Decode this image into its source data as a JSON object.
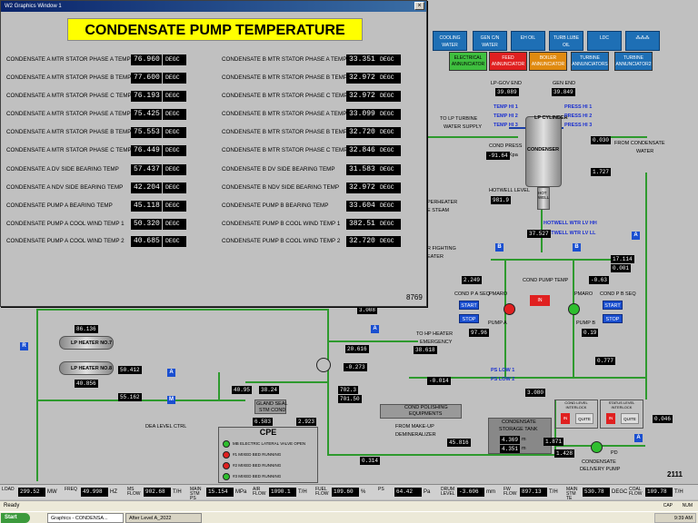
{
  "popup": {
    "window_title": "W2 Graphics Window 1",
    "close_glyph": "×",
    "banner": "CONDENSATE PUMP TEMPERATURE",
    "code": "8769",
    "left_rows": [
      {
        "label": "CONDENSATE  A MTR STATOR PHASE A TEMP 1",
        "value": "76.960",
        "unit": "DEGC"
      },
      {
        "label": "CONDENSATE  A MTR STATOR PHASE B TEMP 1",
        "value": "77.600",
        "unit": "DEGC"
      },
      {
        "label": "CONDENSATE  A MTR STATOR PHASE C TEMP 1",
        "value": "76.193",
        "unit": "DEGC"
      },
      {
        "label": "CONDENSATE  A MTR STATOR PHASE A TEMP 2",
        "value": "75.425",
        "unit": "DEGC"
      },
      {
        "label": "CONDENSATE  A MTR STATOR PHASE B TEMP 2",
        "value": "75.553",
        "unit": "DEGC"
      },
      {
        "label": "CONDENSATE  A MTR STATOR PHASE C TEMP 2",
        "value": "76.449",
        "unit": "DEGC"
      },
      {
        "label": "CONDENSATE A DV SIDE BEARING TEMP",
        "value": "57.437",
        "unit": "DEGC"
      },
      {
        "label": "CONDENSATE A NDV SIDE BEARING TEMP",
        "value": "42.204",
        "unit": "DEGC"
      },
      {
        "label": "CONDENSATE PUMP A BEARING TEMP",
        "value": "45.118",
        "unit": "DEGC"
      },
      {
        "label": "CONDENSATE PUMP A COOL WIND TEMP 1",
        "value": "50.320",
        "unit": "DEGC"
      },
      {
        "label": "CONDENSATE PUMP A COOL WIND TEMP 2",
        "value": "40.685",
        "unit": "DEGC"
      }
    ],
    "right_rows": [
      {
        "label": "CONDENSATE  B MTR STATOR PHASE A TEMP 1",
        "value": "33.351",
        "unit": "DEGC"
      },
      {
        "label": "CONDENSATE  B MTR STATOR PHASE B TEMP 1",
        "value": "32.972",
        "unit": "DEGC"
      },
      {
        "label": "CONDENSATE  B MTR STATOR PHASE C TEMP 1",
        "value": "32.972",
        "unit": "DEGC"
      },
      {
        "label": "CONDENSATE  B MTR STATOR PHASE A TEMP 2",
        "value": "33.099",
        "unit": "DEGC"
      },
      {
        "label": "CONDENSATE  B MTR STATOR PHASE B TEMP 2",
        "value": "32.720",
        "unit": "DEGC"
      },
      {
        "label": "CONDENSATE  B MTR STATOR PHASE C TEMP 2",
        "value": "32.846",
        "unit": "DEGC"
      },
      {
        "label": "CONDENSATE B DV SIDE BEARING TEMP",
        "value": "31.583",
        "unit": "DEGC"
      },
      {
        "label": "CONDENSATE B NDV SIDE BEARING TEMP",
        "value": "32.972",
        "unit": "DEGC"
      },
      {
        "label": "CONDENSATE PUMP B BEARING TEMP",
        "value": "33.604",
        "unit": "DEGC"
      },
      {
        "label": "CONDENSATE PUMP B COOL WIND TEMP 1",
        "value": "382.51",
        "unit": "DEGC"
      },
      {
        "label": "CONDENSATE PUMP B COOL WIND TEMP 2",
        "value": "32.720",
        "unit": "DEGC"
      }
    ]
  },
  "topbar": {
    "buttons": [
      "COOLING WATER",
      "GEN C/N WATER",
      "EH OIL",
      "TURB LUBE OIL",
      "LDC"
    ],
    "annunciators": [
      {
        "label": "ELECTRICAL ANNUNCIATOR",
        "color": "#3fbf3f"
      },
      {
        "label": "FEED ANNUNCIATOR",
        "color": "#e02020"
      },
      {
        "label": "BOILER ANNUNCIATOR",
        "color": "#e08a10"
      },
      {
        "label": "TURBINE ANNUNCIATORS",
        "color": "#1e6fb5"
      },
      {
        "label": "TURBINE ANNUNCIATOR2",
        "color": "#1e6fb5"
      }
    ]
  },
  "scada": {
    "labels": {
      "lp_gov_end": "LP-GOV END",
      "gen_end": "GEN END",
      "lp_gov_val": "39.089",
      "gen_end_val": "39.849",
      "lp_cylinder": "LP CYLINDER",
      "to_lp_turbine": "TO LP TURBINE",
      "water_supply": "WATER SUPPLY",
      "temp_hi1": "TEMP HI 1",
      "temp_hi2": "TEMP HI 2",
      "temp_hi3": "TEMP HI 3",
      "press_hi1": "PRESS HI 1",
      "press_hi2": "PRESS HI 2",
      "press_hi3": "PRESS HI 3",
      "cond_press": "COND PRESS",
      "cond_press_val": "-91.64",
      "cond_press_unit": "Kpa",
      "condenser": "CONDENSER",
      "hotwell_level": "HOTWELL LEVEL",
      "hotwell_level_val": "981.9",
      "hot_well": "HOT WELL",
      "hotwell_hh": "HOTWELL WTR LV HH",
      "hotwell_ll": "HOTWELL WTR LV LL",
      "superheater": "PERHEATER",
      "steam": "E STEAM",
      "fighting": "R FIGHTING",
      "heater": "EATER",
      "from_condensate": "FROM CONDENSATE",
      "water": "WATER",
      "from_cond_val1": "0.030",
      "from_cond_val2": "1.727",
      "val_37": "37.527",
      "val_2249": "2.249",
      "val_063": "-0.63",
      "cond_pump_temp": "COND PUMP TEMP",
      "cond_p_a_seq": "COND P A SEQ",
      "cond_p_b_seq": "COND P B SEQ",
      "pmaro_a": "PMARO",
      "pmaro_b": "PMARO",
      "start": "START",
      "stop": "STOP",
      "pump_a": "PUMP A",
      "pump_b": "PUMP B",
      "pump_a_val": "97.96",
      "pump_b_val": "0.19",
      "ps_low1": "PS LOW 1",
      "ps_low2": "PS LOW 2",
      "val_17114": "17.114",
      "val_0001": "0.001",
      "val_0777": "0.777",
      "val_3080": "3.080",
      "lp_heater7": "LP HEATER NO.7",
      "lp_heater8": "LP HEATER NO.8",
      "lp7_val": "86.136",
      "lp8_val": "40.856",
      "lp_a_val": "50.412",
      "lp_b_val": "55.162",
      "val_3008": "3.008",
      "to_hp_heater": "TO HP HEATER",
      "emergency": "EMERGENCY",
      "val_2061": "20.616",
      "val_3861": "38.618",
      "val_0273": "-0.273",
      "val_4095": "40.95",
      "val_3824": "38.24",
      "gland_seal": "GLAND SEAL",
      "stm_cond": "STM COND",
      "val_6583": "6.583",
      "val_2923": "2.923",
      "val_7023": "702.3",
      "val_7015": "701.50",
      "val_neg001": "-0.014",
      "cond_polishing": "COND POLISHING",
      "equipments": "EQUIPMENTS",
      "from_make_up": "FROM MAKE-UP",
      "demineralizer": "DEMINERALIZER",
      "val_4581": "45.816",
      "val_0314": "0.314",
      "cond_storage_tank": "CONDENSATE",
      "storage_tank": "STORAGE TANK",
      "tank_val1": "4.369",
      "tank_val2": "4.351",
      "tank_unit": "m",
      "val_1871": "1.871",
      "val_1428": "1.428",
      "cond_delivery_pump": "CONDENSATE",
      "delivery_pump": "DELIVERY PUMP",
      "pd": "PD",
      "dea_level": "DEA LEVEL CTRL",
      "cpe": "CPE",
      "cpe_items": [
        "MB ELECTRIC LATERAL VALVE OPEN",
        "#1 MIXED BED RUNNING",
        "#2 MIXED BED RUNNING",
        "#3 MIXED BED RUNNING"
      ],
      "cpe_colors": [
        "#2fbf2f",
        "#e02020",
        "#e02020",
        "#2fbf2f"
      ],
      "cond_lvl_interlock": "COND LEVEL INTERLOCK",
      "status_level": "STATUS LEVEL INTERLOCK",
      "in": "IN",
      "quite": "QUITE",
      "val_0046": "0.046",
      "code_2111": "2111"
    }
  },
  "statusbar": [
    {
      "label": "LOAD",
      "value": "299.52",
      "unit": "MW"
    },
    {
      "label": "FREQ",
      "value": "49.998",
      "unit": "HZ"
    },
    {
      "label": "MS FLOW",
      "value": "902.68",
      "unit": "T/H"
    },
    {
      "label": "MAIN STM PS",
      "value": "15.154",
      "unit": "MPa"
    },
    {
      "label": "AIR FLOW",
      "value": "1090.1",
      "unit": "T/H"
    },
    {
      "label": "FUEL FLOW",
      "value": "109.60",
      "unit": "%"
    },
    {
      "label": "PS",
      "value": "64.42",
      "unit": "Pa"
    },
    {
      "label": "DRUM LEVEL",
      "value": "-3.606",
      "unit": "mm"
    },
    {
      "label": "FW FLOW",
      "value": "897.13",
      "unit": "T/H"
    },
    {
      "label": "MAIN STM TE",
      "value": "530.78",
      "unit": "DEGC"
    },
    {
      "label": "COAL FLOW",
      "value": "109.78",
      "unit": "T/H"
    }
  ],
  "ready_text": "Ready",
  "caps_indicator": "CAP",
  "num_indicator": "NUM",
  "taskbar": {
    "start": "Start",
    "items": [
      "Graphics - CONDENSA...",
      "After Level A_2022"
    ],
    "time": "9:39 AM"
  }
}
